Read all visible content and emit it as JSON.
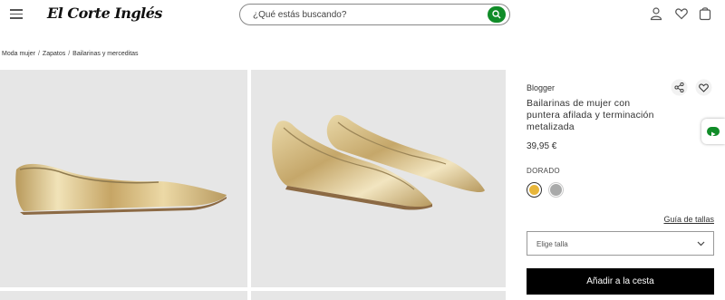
{
  "header": {
    "logo_text": "El Corte Inglés",
    "search_placeholder": "¿Qué estás buscando?"
  },
  "breadcrumb": [
    "Moda mujer",
    "Zapatos",
    "Bailarinas y merceditas"
  ],
  "product": {
    "brand": "Blogger",
    "title": "Bailarinas de mujer con puntera afilada y terminación metalizada",
    "price": "39,95 €",
    "color_label": "DORADO",
    "swatches": [
      {
        "name": "gold",
        "color": "#e8b63a",
        "selected": true
      },
      {
        "name": "silver",
        "color": "#a9aaaa",
        "selected": false
      }
    ],
    "size_guide": "Guía de tallas",
    "size_placeholder": "Elige talla",
    "add_to_cart": "Añadir a la cesta"
  },
  "colors": {
    "brand_green": "#108c28",
    "image_bg": "#e6e6e6",
    "gold_shoe": "#d9bf7d"
  },
  "icons": [
    "menu-icon",
    "search-icon",
    "user-icon",
    "heart-icon",
    "bag-icon",
    "share-icon",
    "chevron-down-icon",
    "chat-icon"
  ]
}
